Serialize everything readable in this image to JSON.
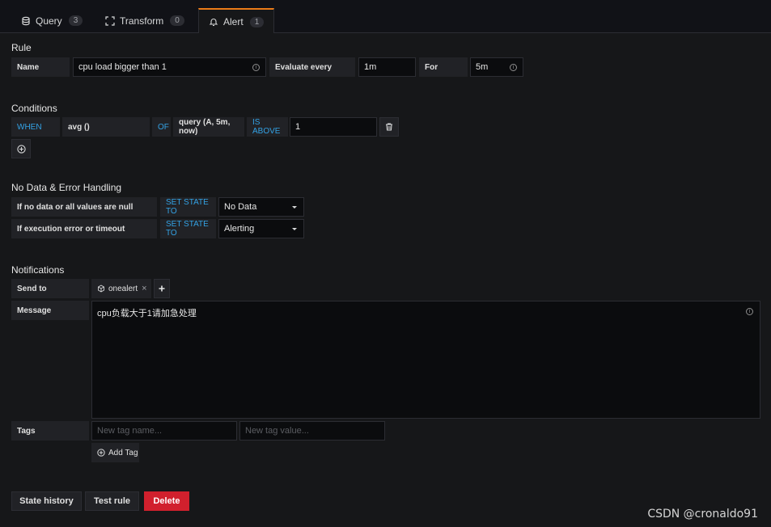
{
  "tabs": [
    {
      "label": "Query",
      "count": "3"
    },
    {
      "label": "Transform",
      "count": "0"
    },
    {
      "label": "Alert",
      "count": "1"
    }
  ],
  "rule": {
    "title": "Rule",
    "name_label": "Name",
    "name_value": "cpu load bigger than 1",
    "evaluate_label": "Evaluate every",
    "evaluate_value": "1m",
    "for_label": "For",
    "for_value": "5m"
  },
  "conditions": {
    "title": "Conditions",
    "when": "WHEN",
    "reducer": "avg ()",
    "of": "OF",
    "query": "query (A, 5m, now)",
    "evaluator": "IS ABOVE",
    "threshold": "1"
  },
  "nodata": {
    "title": "No Data & Error Handling",
    "row1_label": "If no data or all values are null",
    "row1_action": "SET STATE TO",
    "row1_value": "No Data",
    "row2_label": "If execution error or timeout",
    "row2_action": "SET STATE TO",
    "row2_value": "Alerting"
  },
  "notifications": {
    "title": "Notifications",
    "send_to_label": "Send to",
    "channel": "onealert",
    "message_label": "Message",
    "message_value": "cpu负载大于1请加急处理",
    "tags_label": "Tags",
    "tag_name_placeholder": "New tag name...",
    "tag_value_placeholder": "New tag value...",
    "add_tag": "Add Tag"
  },
  "footer": {
    "state_history": "State history",
    "test_rule": "Test rule",
    "delete": "Delete"
  },
  "watermark": "CSDN @cronaldo91",
  "colors": {
    "accent_tab": "#eb7b18",
    "keyword_blue": "#33a2e5",
    "danger": "#d1202d"
  }
}
